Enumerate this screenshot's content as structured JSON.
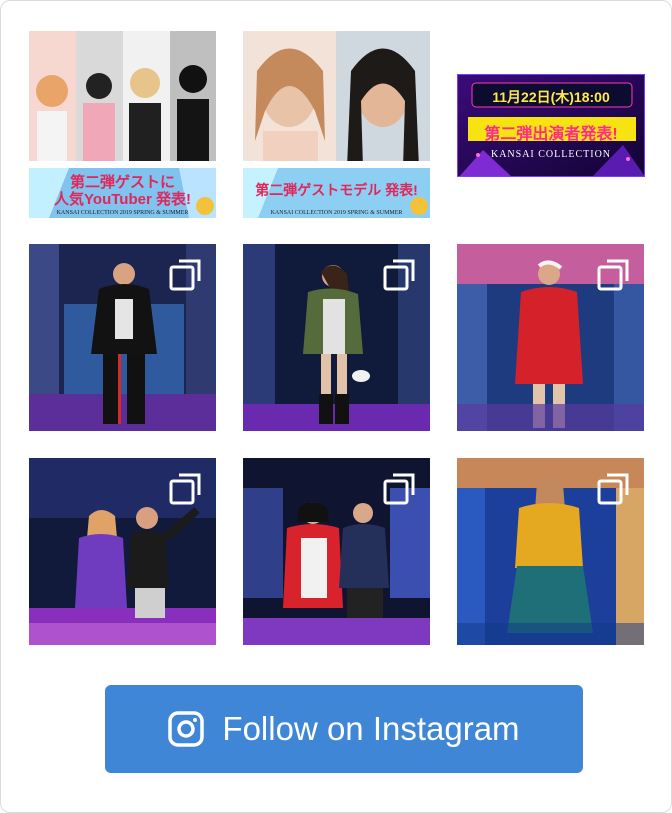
{
  "colors": {
    "button_bg": "#3f86d6",
    "button_text": "#ffffff",
    "frame_border": "#dcdcdc"
  },
  "posts": [
    {
      "type": "image",
      "caption_line1": "第二弾ゲストに",
      "caption_line2": "人気YouTuber 発表!",
      "footer": "KANSAI COLLECTION 2019 SPRING & SUMMER"
    },
    {
      "type": "image",
      "caption_line1": "第二弾ゲストモデル 発表!",
      "footer": "KANSAI COLLECTION 2019 SPRING & SUMMER"
    },
    {
      "type": "image",
      "date_text": "11月22日(木)18:00",
      "headline": "第二弾出演者発表!",
      "logo": "KANSAI COLLECTION"
    },
    {
      "type": "carousel",
      "icon": "multiple-photos-icon"
    },
    {
      "type": "carousel",
      "icon": "multiple-photos-icon"
    },
    {
      "type": "carousel",
      "icon": "multiple-photos-icon"
    },
    {
      "type": "carousel",
      "icon": "multiple-photos-icon"
    },
    {
      "type": "carousel",
      "icon": "multiple-photos-icon"
    },
    {
      "type": "carousel",
      "icon": "multiple-photos-icon"
    }
  ],
  "follow_button": {
    "label": "Follow on Instagram",
    "icon": "instagram-icon"
  }
}
